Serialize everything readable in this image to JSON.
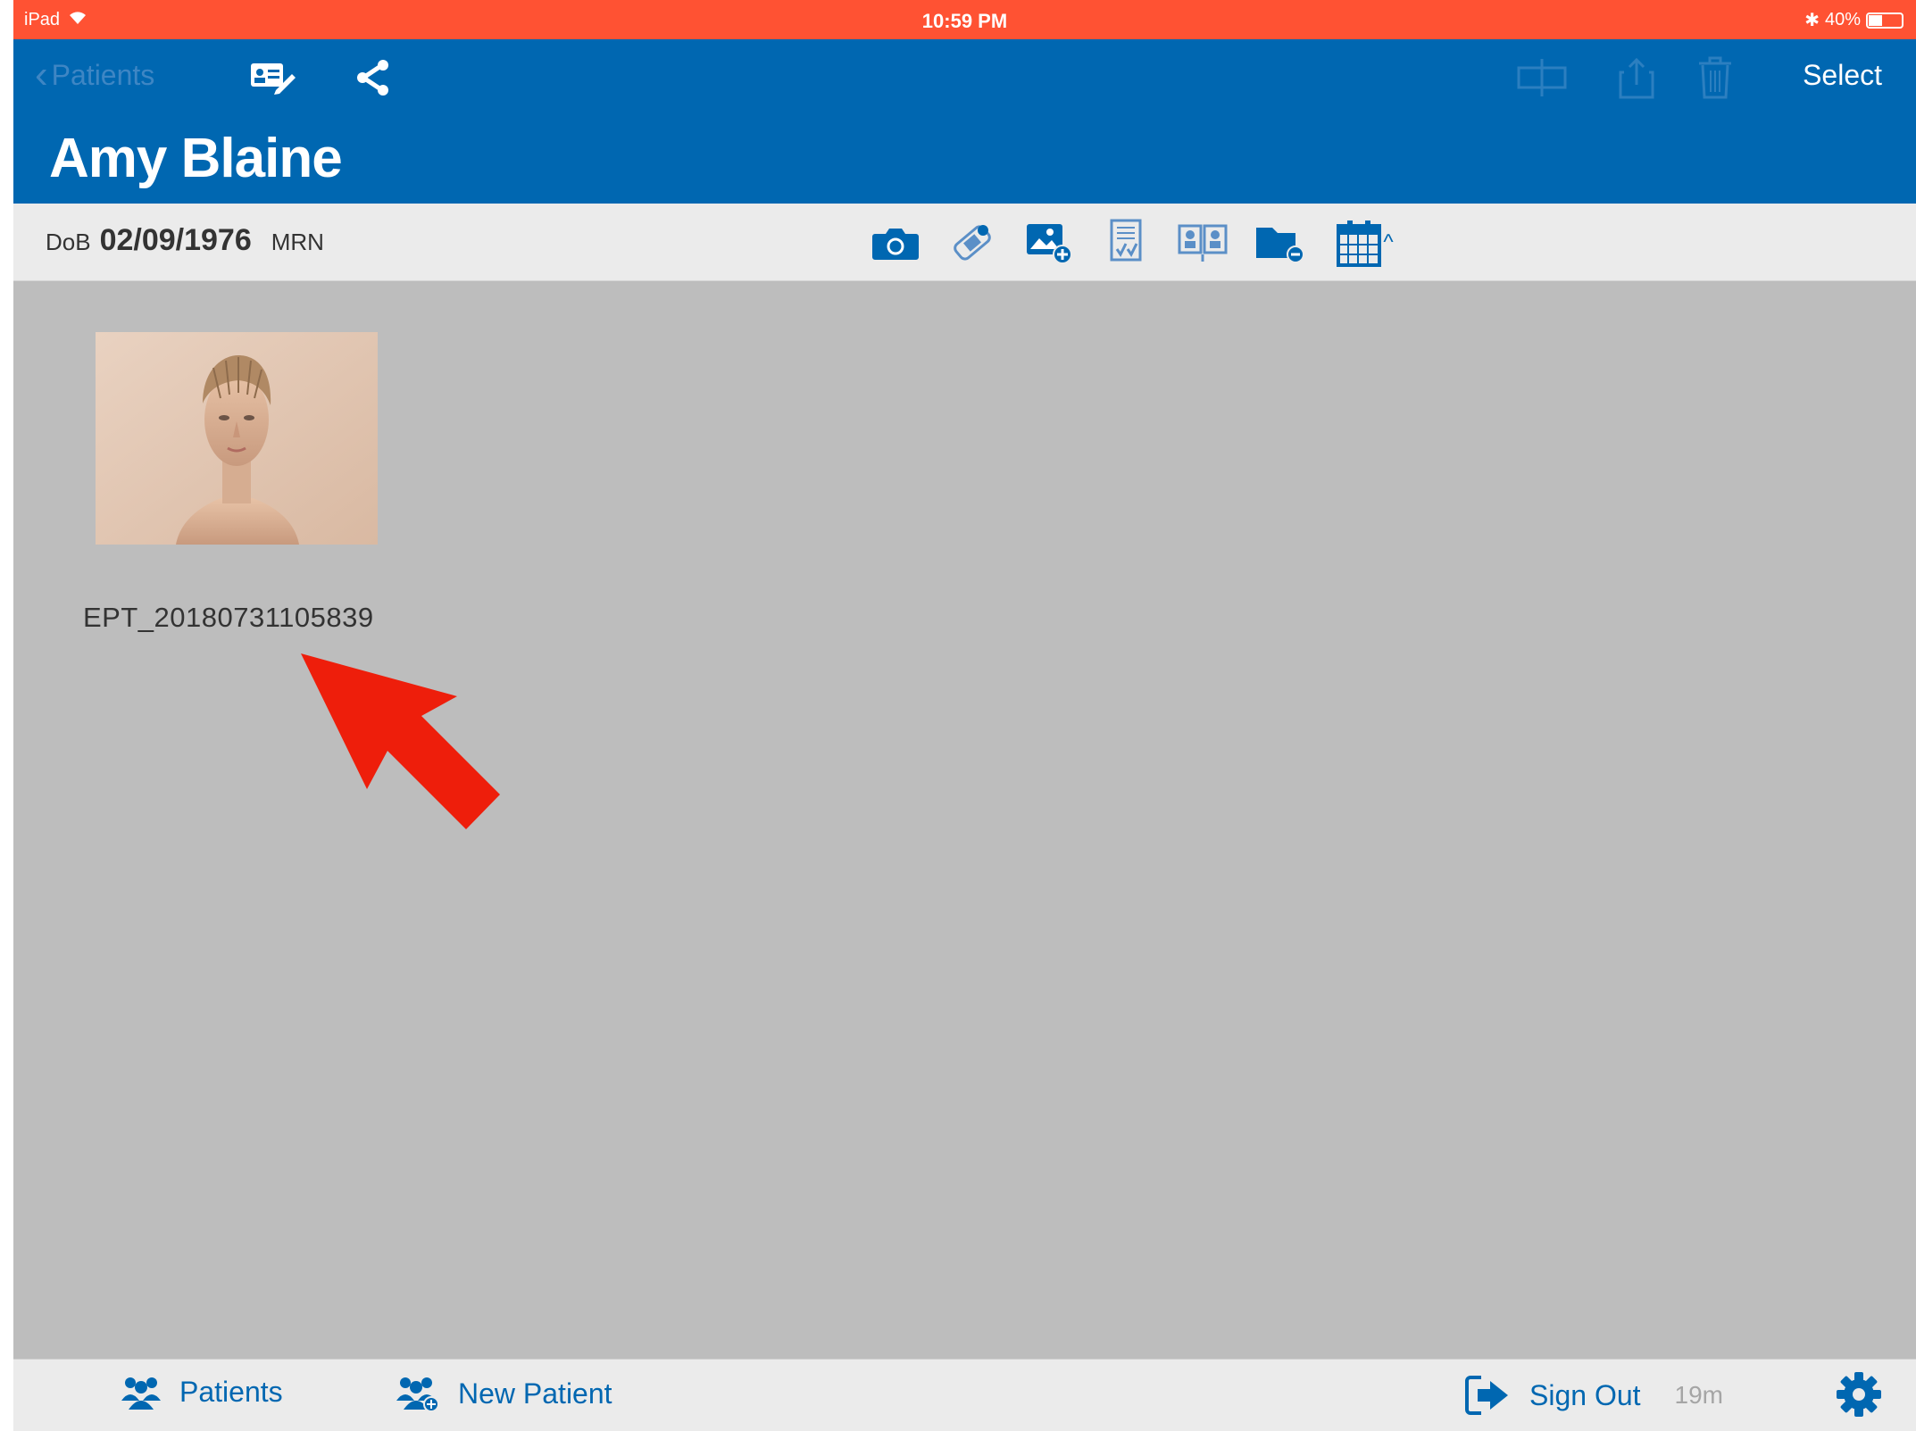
{
  "status_bar": {
    "device": "iPad",
    "time": "10:59 PM",
    "battery": "40%"
  },
  "nav": {
    "back_label": "Patients",
    "title": "Amy Blaine",
    "select_label": "Select"
  },
  "info": {
    "dob_label": "DoB",
    "dob_value": "02/09/1976",
    "mrn_label": "MRN"
  },
  "toolbar": {
    "icons": [
      "camera-icon",
      "dressing-icon",
      "add-photo-icon",
      "checklist-icon",
      "compare-icon",
      "folder-icon",
      "calendar-icon"
    ],
    "chevron": "^"
  },
  "gallery": {
    "items": [
      {
        "caption": "EPT_20180731105839"
      }
    ]
  },
  "tabbar": {
    "patients_label": "Patients",
    "new_patient_label": "New Patient",
    "sign_out_label": "Sign Out",
    "timer": "19m"
  },
  "colors": {
    "status_bar": "#ff5233",
    "nav_blue": "#0067b1",
    "background": "#bdbdbd",
    "arrow": "#ee1e0b"
  }
}
